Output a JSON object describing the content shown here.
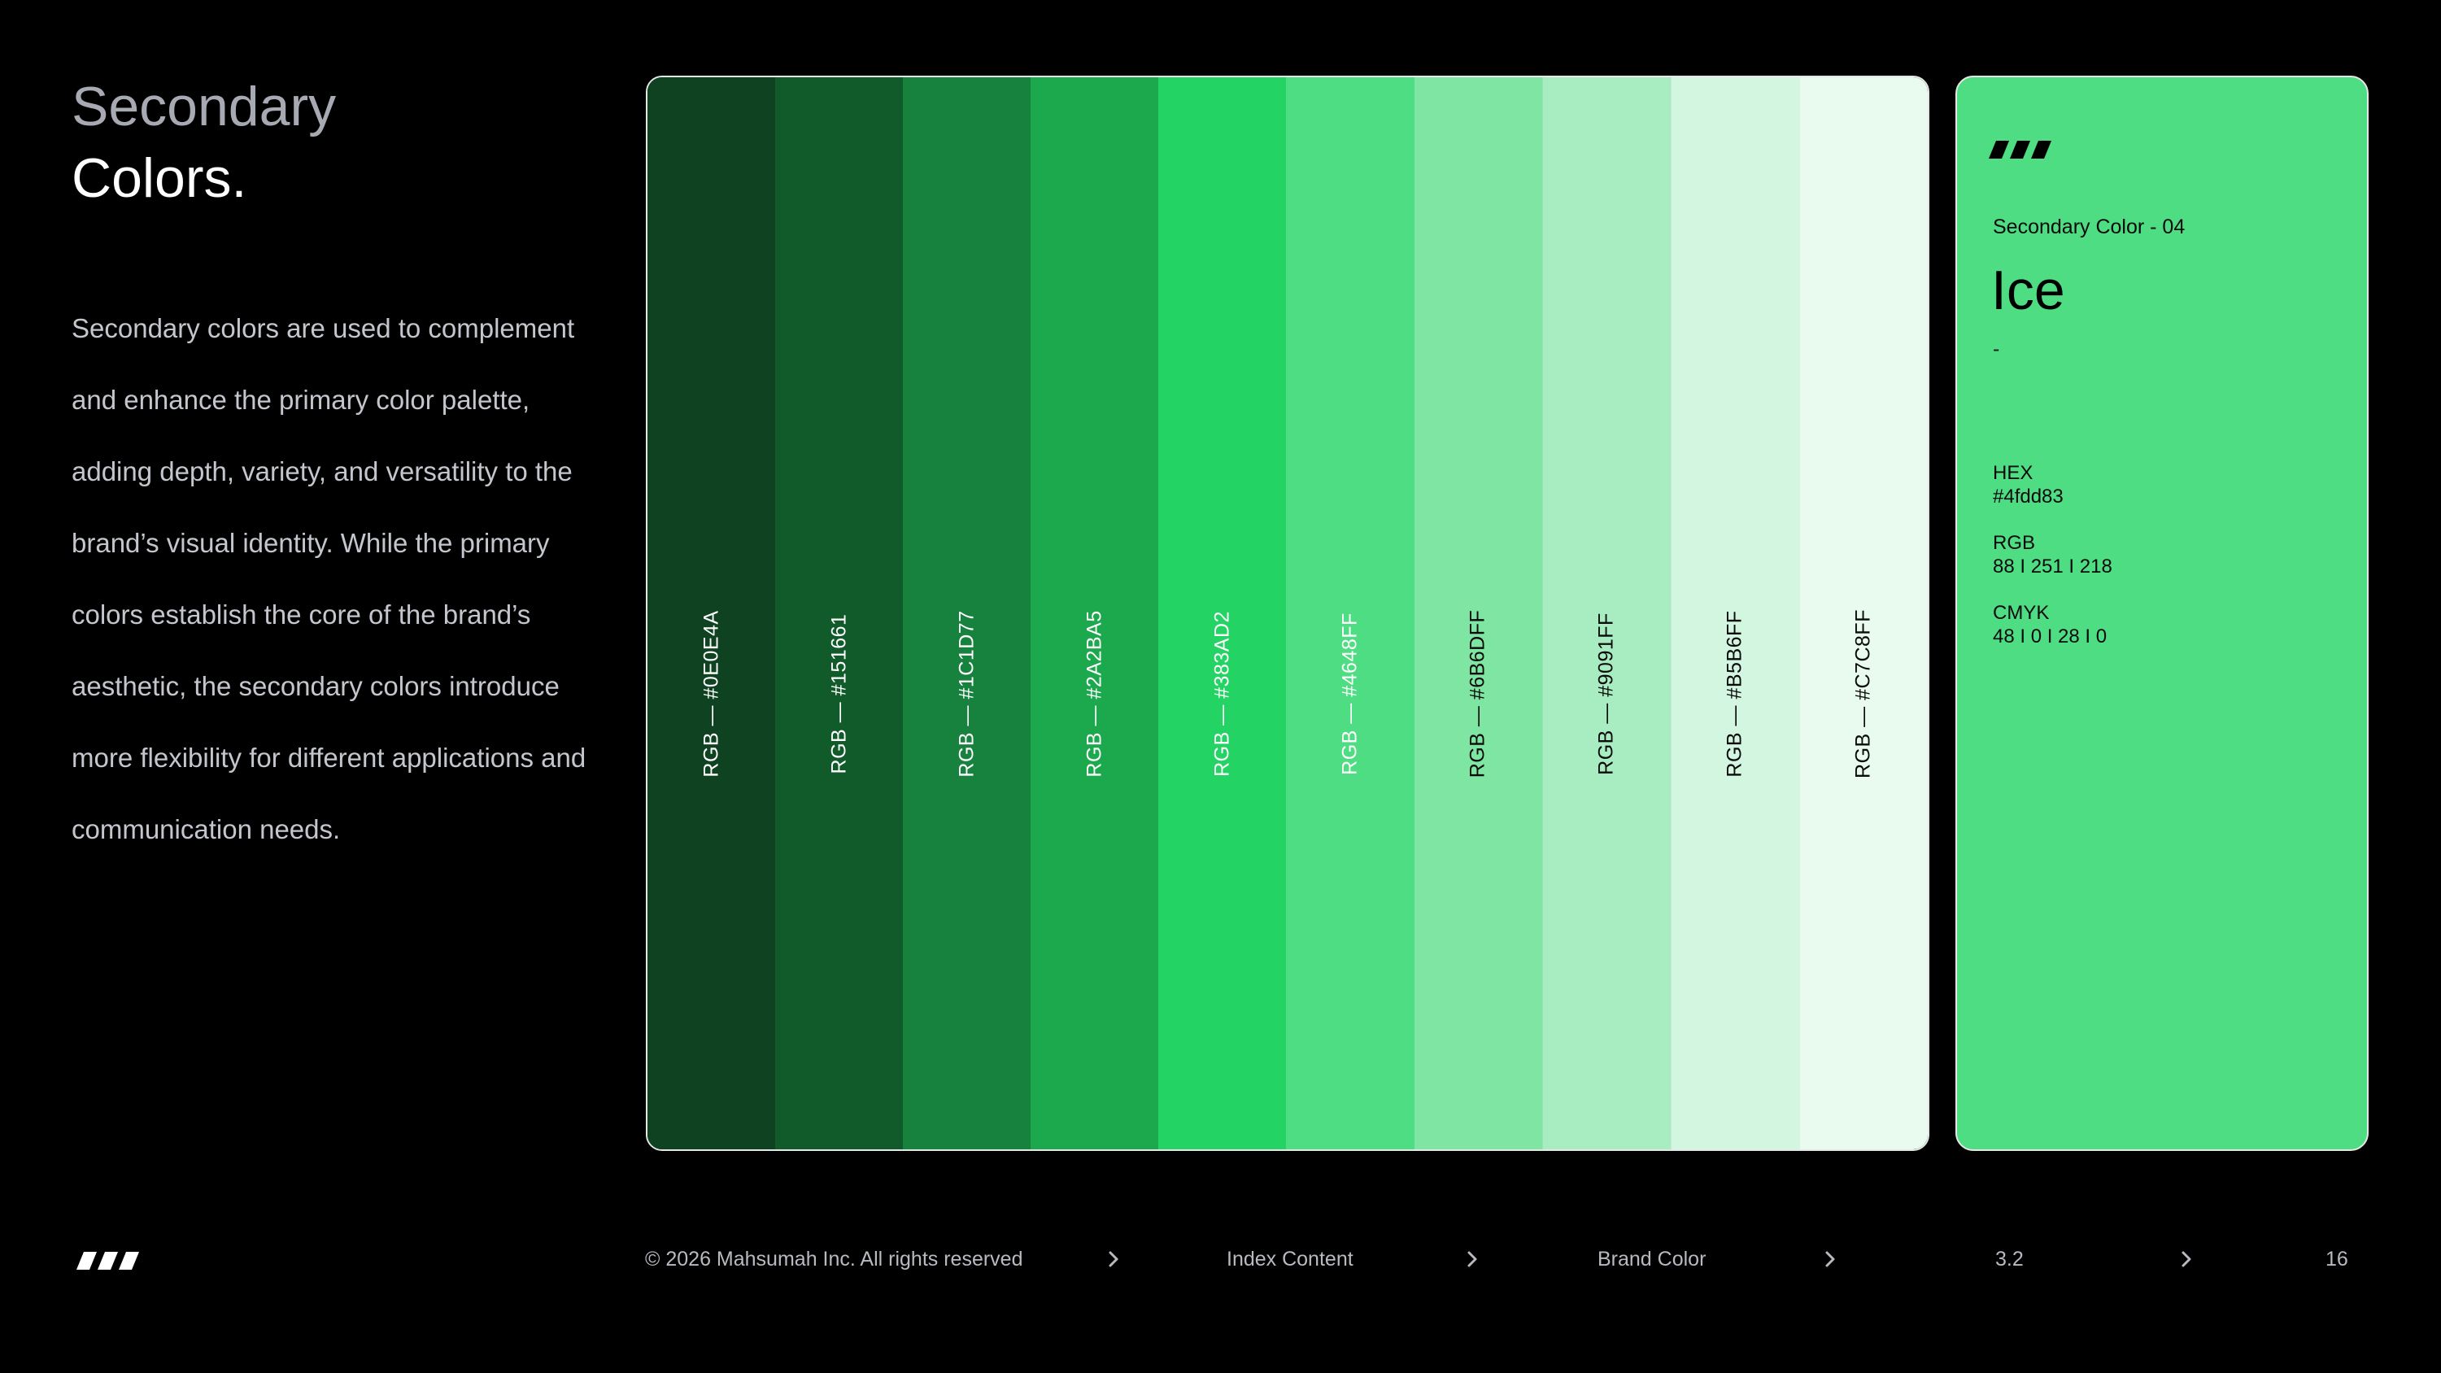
{
  "heading": {
    "line1": "Secondary",
    "line2": "Colors."
  },
  "description": "Secondary colors are used to complement and enhance the primary color palette, adding depth, variety, and versatility to the brand’s visual identity. While the primary colors establish the core of the brand’s aesthetic, the secondary colors introduce more flexibility for different applications and communication needs.",
  "swatches": [
    {
      "label": "RGB — #0E0E4A",
      "color": "#0f4220",
      "text_color": "#ffffff"
    },
    {
      "label": "RGB — #151661",
      "color": "#115b2b",
      "text_color": "#ffffff"
    },
    {
      "label": "RGB — #1C1D77",
      "color": "#16823d",
      "text_color": "#ffffff"
    },
    {
      "label": "RGB — #2A2BA5",
      "color": "#1ca84d",
      "text_color": "#ffffff"
    },
    {
      "label": "RGB — #383AD2",
      "color": "#23d363",
      "text_color": "#ffffff"
    },
    {
      "label": "RGB — #4648FF",
      "color": "#4fdd83",
      "text_color": "#ffffff"
    },
    {
      "label": "RGB — #6B6DFF",
      "color": "#7ee6a2",
      "text_color": "#0a0a0a"
    },
    {
      "label": "RGB — #9091FF",
      "color": "#a8edc1",
      "text_color": "#0a0a0a"
    },
    {
      "label": "RGB — #B5B6FF",
      "color": "#d3f6e0",
      "text_color": "#0a0a0a"
    },
    {
      "label": "RGB — #C7C8FF",
      "color": "#e9fbef",
      "text_color": "#0a0a0a"
    }
  ],
  "card": {
    "subtitle": "Secondary Color - 04",
    "name": "Ice",
    "dash": "-",
    "hex_label": "HEX",
    "hex_value": "#4fdd83",
    "rgb_label": "RGB",
    "rgb_value": "88 I 251 I 218",
    "cmyk_label": "CMYK",
    "cmyk_value": "48 I 0 I 28 I 0",
    "background": "#4fdd83"
  },
  "footer": {
    "copyright": "© 2026 Mahsumah Inc. All rights reserved",
    "index": "Index Content",
    "section": "Brand Color",
    "subsection": "3.2",
    "page": "16"
  },
  "icons": {
    "logo": "brand-logo-icon",
    "separator": "chevron-right-icon"
  }
}
